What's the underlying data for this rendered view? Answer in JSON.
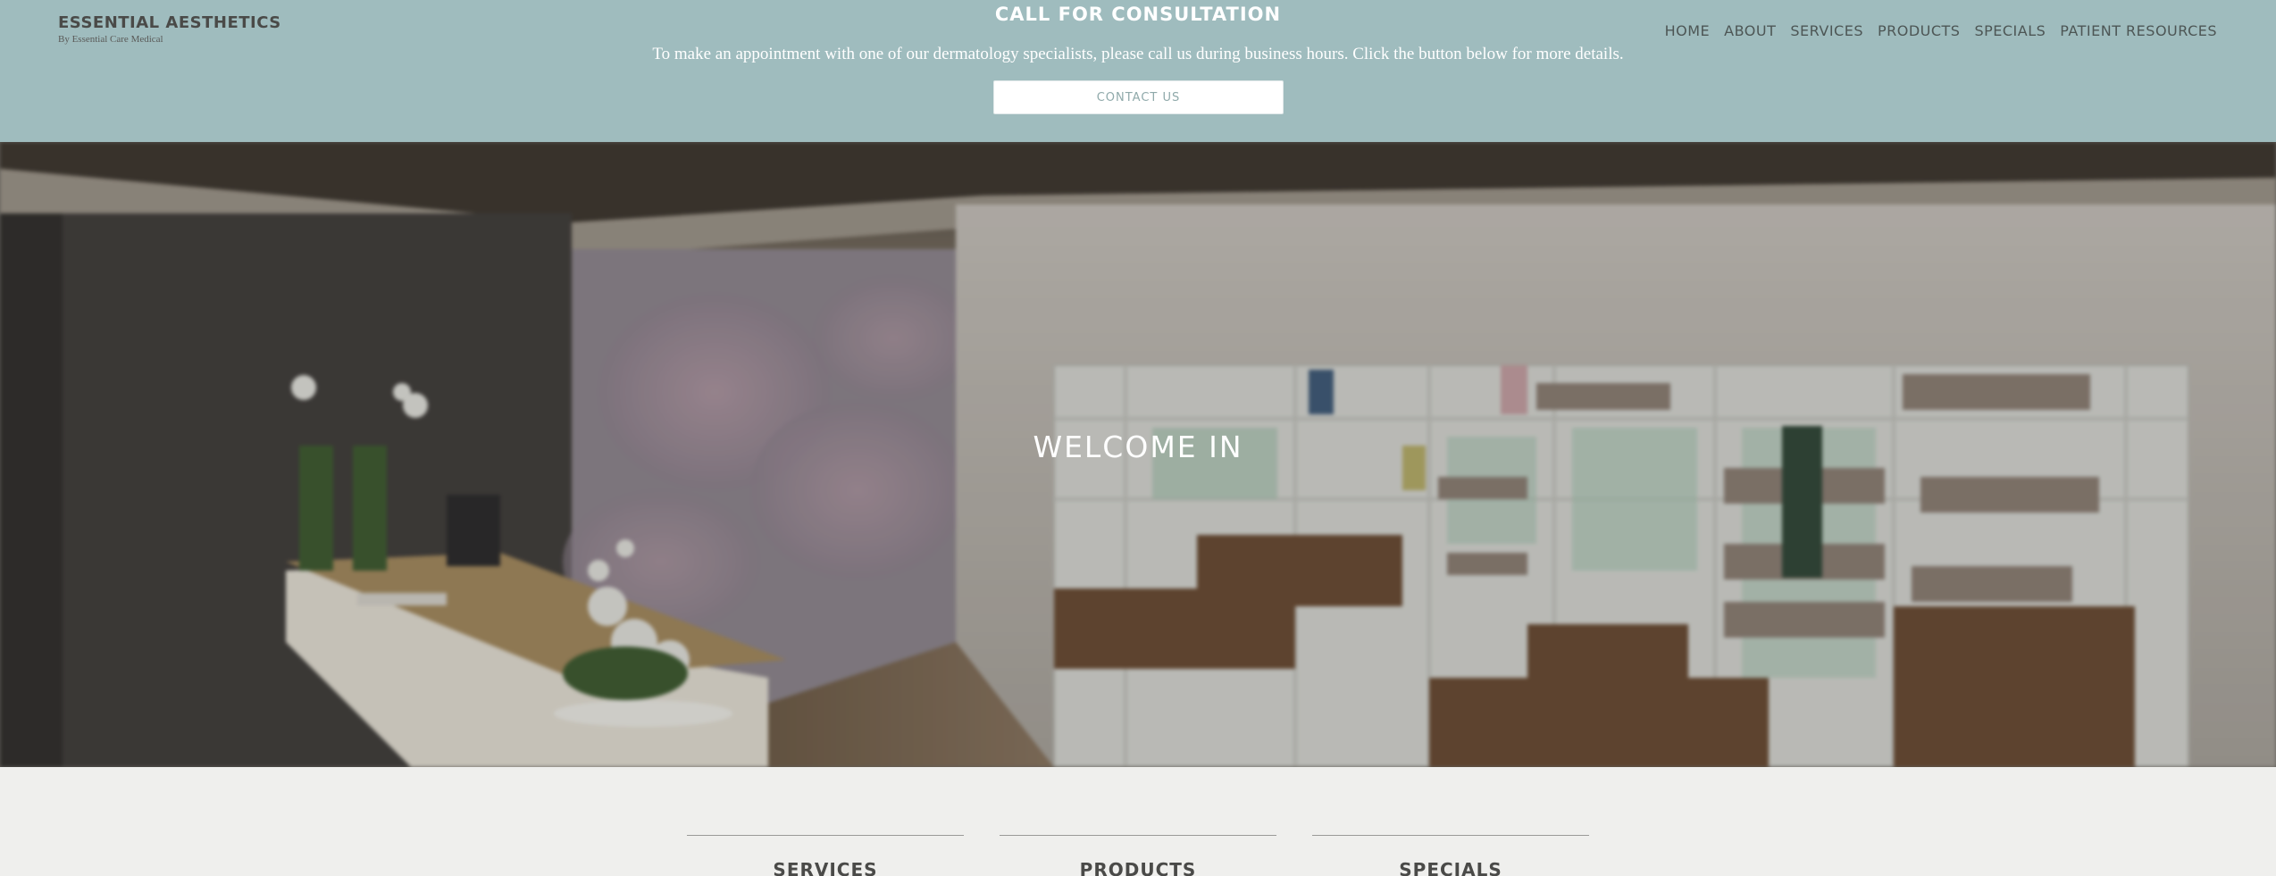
{
  "brand": {
    "title": "ESSENTIAL AESTHETICS",
    "subtitle": "By Essential Care Medical"
  },
  "promo": {
    "title": "CALL FOR CONSULTATION",
    "text": "To make an appointment with one of our dermatology specialists, please call us during business hours. Click the button below for more details.",
    "button_label": "CONTACT US"
  },
  "nav": {
    "items": [
      "HOME",
      "ABOUT",
      "SERVICES",
      "PRODUCTS",
      "SPECIALS",
      "PATIENT RESOURCES"
    ]
  },
  "hero": {
    "title": "WELCOME IN"
  },
  "features": {
    "items": [
      "SERVICES",
      "PRODUCTS",
      "SPECIALS"
    ]
  },
  "colors": {
    "header_bg": "#9fbcbe",
    "page_bg": "#efefed",
    "text_dark": "#4a4a48",
    "button_text": "#8fa9aa"
  }
}
